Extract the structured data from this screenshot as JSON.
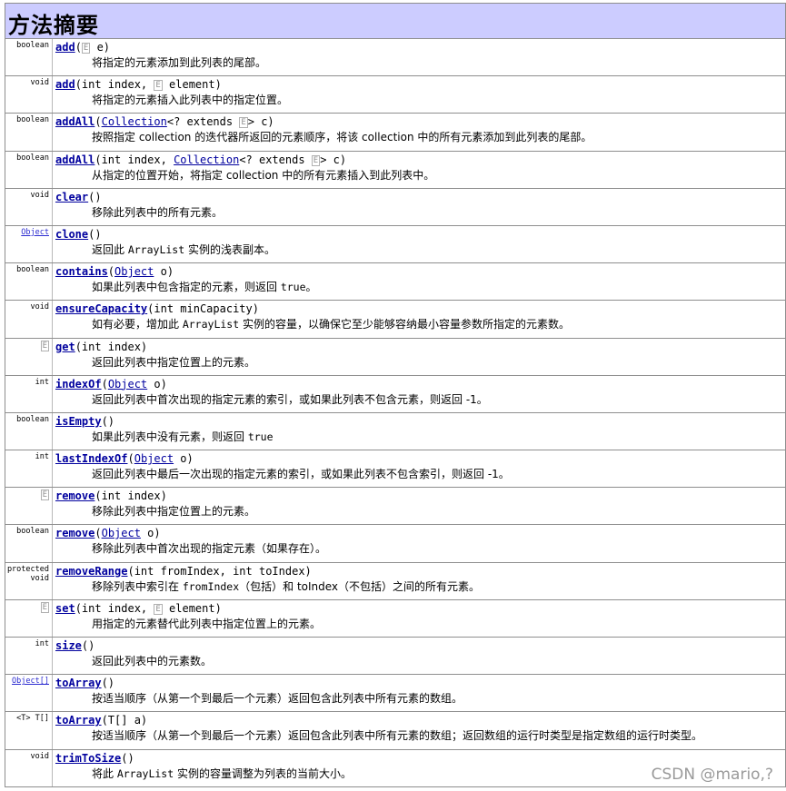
{
  "header": {
    "title": "方法摘要"
  },
  "methods": [
    {
      "type": "boolean",
      "name": "add",
      "sig_before": "(",
      "tp1": "E",
      "sig_after": " e)",
      "desc": "将指定的元素添加到此列表的尾部。"
    },
    {
      "type": "void",
      "name": "add",
      "sig_before": "(int index, ",
      "tp1": "E",
      "sig_after": " element)",
      "desc": "将指定的元素插入此列表中的指定位置。"
    },
    {
      "type": "boolean",
      "name": "addAll",
      "sig_before": "(",
      "link": "Collection",
      "mid": "<? extends ",
      "tp1": "E",
      "sig_after": "> c)",
      "desc": "按照指定 collection 的迭代器所返回的元素顺序，将该 collection 中的所有元素添加到此列表的尾部。"
    },
    {
      "type": "boolean",
      "name": "addAll",
      "sig_before": "(int index, ",
      "link": "Collection",
      "mid": "<? extends ",
      "tp1": "E",
      "sig_after": "> c)",
      "desc": "从指定的位置开始，将指定 collection 中的所有元素插入到此列表中。"
    },
    {
      "type": "void",
      "name": "clear",
      "sig_before": "()",
      "desc": "移除此列表中的所有元素。"
    },
    {
      "type": "Object",
      "type_is_link": true,
      "name": "clone",
      "sig_before": "()",
      "desc_pre": "返回此 ",
      "desc_code": "ArrayList",
      "desc_post": " 实例的浅表副本。"
    },
    {
      "type": "boolean",
      "name": "contains",
      "sig_before": "(",
      "link": "Object",
      "sig_after": " o)",
      "desc_pre": "如果此列表中包含指定的元素，则返回 ",
      "desc_code": "true",
      "desc_post": "。"
    },
    {
      "type": "void",
      "name": "ensureCapacity",
      "sig_before": "(int minCapacity)",
      "desc_pre": "如有必要，增加此 ",
      "desc_code": "ArrayList",
      "desc_post": " 实例的容量，以确保它至少能够容纳最小容量参数所指定的元素数。"
    },
    {
      "type": "E",
      "type_is_tparam": true,
      "name": "get",
      "sig_before": "(int index)",
      "desc": "返回此列表中指定位置上的元素。"
    },
    {
      "type": "int",
      "name": "indexOf",
      "sig_before": "(",
      "link": "Object",
      "sig_after": " o)",
      "desc": "返回此列表中首次出现的指定元素的索引，或如果此列表不包含元素，则返回 -1。"
    },
    {
      "type": "boolean",
      "name": "isEmpty",
      "sig_before": "()",
      "desc_pre": "如果此列表中没有元素，则返回 ",
      "desc_code": "true",
      "desc_post": ""
    },
    {
      "type": "int",
      "name": "lastIndexOf",
      "sig_before": "(",
      "link": "Object",
      "sig_after": " o)",
      "desc": "返回此列表中最后一次出现的指定元素的索引，或如果此列表不包含索引，则返回 -1。"
    },
    {
      "type": "E",
      "type_is_tparam": true,
      "name": "remove",
      "sig_before": "(int index)",
      "desc": "移除此列表中指定位置上的元素。"
    },
    {
      "type": "boolean",
      "name": "remove",
      "sig_before": "(",
      "link": "Object",
      "sig_after": " o)",
      "desc": "移除此列表中首次出现的指定元素（如果存在）。"
    },
    {
      "type": "protected",
      "type2": "void",
      "name": "removeRange",
      "sig_before": "(int fromIndex, int toIndex)",
      "desc_pre": "移除列表中索引在 ",
      "desc_code": "fromIndex",
      "desc_post": "（包括）和 toIndex（不包括）之间的所有元素。"
    },
    {
      "type": "E",
      "type_is_tparam": true,
      "name": "set",
      "sig_before": "(int index, ",
      "tp1": "E",
      "sig_after": " element)",
      "desc": "用指定的元素替代此列表中指定位置上的元素。"
    },
    {
      "type": "int",
      "name": "size",
      "sig_before": "()",
      "desc": "返回此列表中的元素数。"
    },
    {
      "type": "Object[]",
      "type_is_link": true,
      "name": "toArray",
      "sig_before": "()",
      "desc": "按适当顺序（从第一个到最后一个元素）返回包含此列表中所有元素的数组。"
    },
    {
      "type": "<T> T[]",
      "name": "toArray",
      "sig_before": "(T[] a)",
      "desc": "按适当顺序（从第一个到最后一个元素）返回包含此列表中所有元素的数组；返回数组的运行时类型是指定数组的运行时类型。"
    },
    {
      "type": "void",
      "name": "trimToSize",
      "sig_before": "()",
      "desc_pre": "将此 ",
      "desc_code": "ArrayList",
      "desc_post": " 实例的容量调整为列表的当前大小。"
    }
  ],
  "watermark": "CSDN @mario,?",
  "colors": {
    "header_bg": "#ccccff",
    "method_link": "#00009e",
    "type_link": "#2b2bd0",
    "border": "#8e8e8e"
  }
}
